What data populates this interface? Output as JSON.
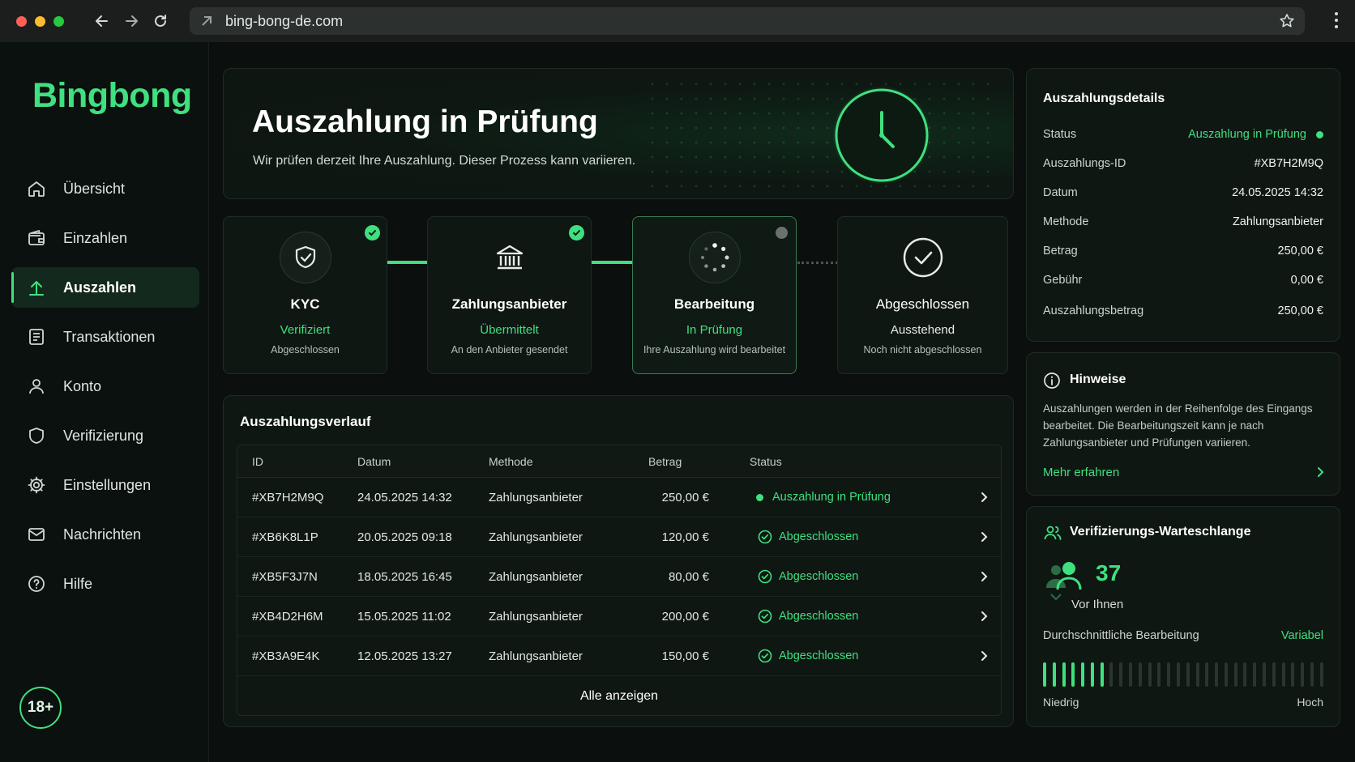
{
  "browser": {
    "url": "bing-bong-de.com"
  },
  "sidebar": {
    "logo": "Bingbong",
    "items": [
      {
        "label": "Übersicht",
        "icon": "home-icon",
        "active": false
      },
      {
        "label": "Einzahlen",
        "icon": "wallet-icon",
        "active": false
      },
      {
        "label": "Auszahlen",
        "icon": "arrow-up-icon",
        "active": true
      },
      {
        "label": "Transaktionen",
        "icon": "receipt-icon",
        "active": false
      },
      {
        "label": "Konto",
        "icon": "user-icon",
        "active": false
      },
      {
        "label": "Verifizierung",
        "icon": "shield-icon",
        "active": false
      },
      {
        "label": "Einstellungen",
        "icon": "gear-icon",
        "active": false
      },
      {
        "label": "Nachrichten",
        "icon": "mail-icon",
        "active": false
      },
      {
        "label": "Hilfe",
        "icon": "help-icon",
        "active": false
      }
    ],
    "age_badge": "18+"
  },
  "hero": {
    "title": "Auszahlung in Prüfung",
    "subtitle": "Wir prüfen derzeit Ihre Auszahlung. Dieser Prozess kann variieren."
  },
  "steps": [
    {
      "title": "KYC",
      "status": "Verifiziert",
      "desc": "Abgeschlossen",
      "icon": "shield-check-icon",
      "state": "done"
    },
    {
      "title": "Zahlungsanbieter",
      "status": "Übermittelt",
      "desc": "An den Anbieter gesendet",
      "icon": "bank-icon",
      "state": "done"
    },
    {
      "title": "Bearbeitung",
      "status": "In Prüfung",
      "desc": "Ihre Auszahlung wird bearbeitet",
      "icon": "spinner-icon",
      "state": "current"
    },
    {
      "title": "Abgeschlossen",
      "status": "Ausstehend",
      "desc": "Noch nicht abgeschlossen",
      "icon": "check-circle-icon",
      "state": "pending"
    }
  ],
  "history": {
    "title": "Auszahlungsverlauf",
    "columns": {
      "id": "ID",
      "date": "Datum",
      "method": "Methode",
      "amount": "Betrag",
      "status": "Status"
    },
    "rows": [
      {
        "id": "#XB7H2M9Q",
        "date": "24.05.2025 14:32",
        "method": "Zahlungsanbieter",
        "amount": "250,00 €",
        "status": "Auszahlung in Prüfung",
        "kind": "review"
      },
      {
        "id": "#XB6K8L1P",
        "date": "20.05.2025 09:18",
        "method": "Zahlungsanbieter",
        "amount": "120,00 €",
        "status": "Abgeschlossen",
        "kind": "done"
      },
      {
        "id": "#XB5F3J7N",
        "date": "18.05.2025 16:45",
        "method": "Zahlungsanbieter",
        "amount": "80,00 €",
        "status": "Abgeschlossen",
        "kind": "done"
      },
      {
        "id": "#XB4D2H6M",
        "date": "15.05.2025 11:02",
        "method": "Zahlungsanbieter",
        "amount": "200,00 €",
        "status": "Abgeschlossen",
        "kind": "done"
      },
      {
        "id": "#XB3A9E4K",
        "date": "12.05.2025 13:27",
        "method": "Zahlungsanbieter",
        "amount": "150,00 €",
        "status": "Abgeschlossen",
        "kind": "done"
      }
    ],
    "show_all": "Alle anzeigen"
  },
  "details": {
    "title": "Auszahlungsdetails",
    "rows": [
      {
        "label": "Status",
        "value": "Auszahlung in Prüfung",
        "highlight": true
      },
      {
        "label": "Auszahlungs-ID",
        "value": "#XB7H2M9Q",
        "highlight": false
      },
      {
        "label": "Datum",
        "value": "24.05.2025 14:32",
        "highlight": false
      },
      {
        "label": "Methode",
        "value": "Zahlungsanbieter",
        "highlight": false
      },
      {
        "label": "Betrag",
        "value": "250,00 €",
        "highlight": false
      },
      {
        "label": "Gebühr",
        "value": "0,00 €",
        "highlight": false
      },
      {
        "label": "Auszahlungsbetrag",
        "value": "250,00 €",
        "highlight": false
      }
    ]
  },
  "hints": {
    "title": "Hinweise",
    "text": "Auszahlungen werden in der Reihenfolge des Eingangs bearbeitet. Die Bearbeitungszeit kann je nach Zahlungsanbieter und Prüfungen variieren.",
    "link": "Mehr erfahren"
  },
  "queue": {
    "title": "Verifizierungs-Warteschlange",
    "count": "37",
    "ahead_label": "Vor Ihnen",
    "avg_label": "Durchschnittliche Bearbeitung",
    "avg_value": "Variabel",
    "bar_total": 30,
    "bar_filled": 7,
    "low_label": "Niedrig",
    "high_label": "Hoch"
  },
  "colors": {
    "accent": "#3fe07f",
    "background": "#0b0f0d",
    "panel": "#0f1713"
  }
}
